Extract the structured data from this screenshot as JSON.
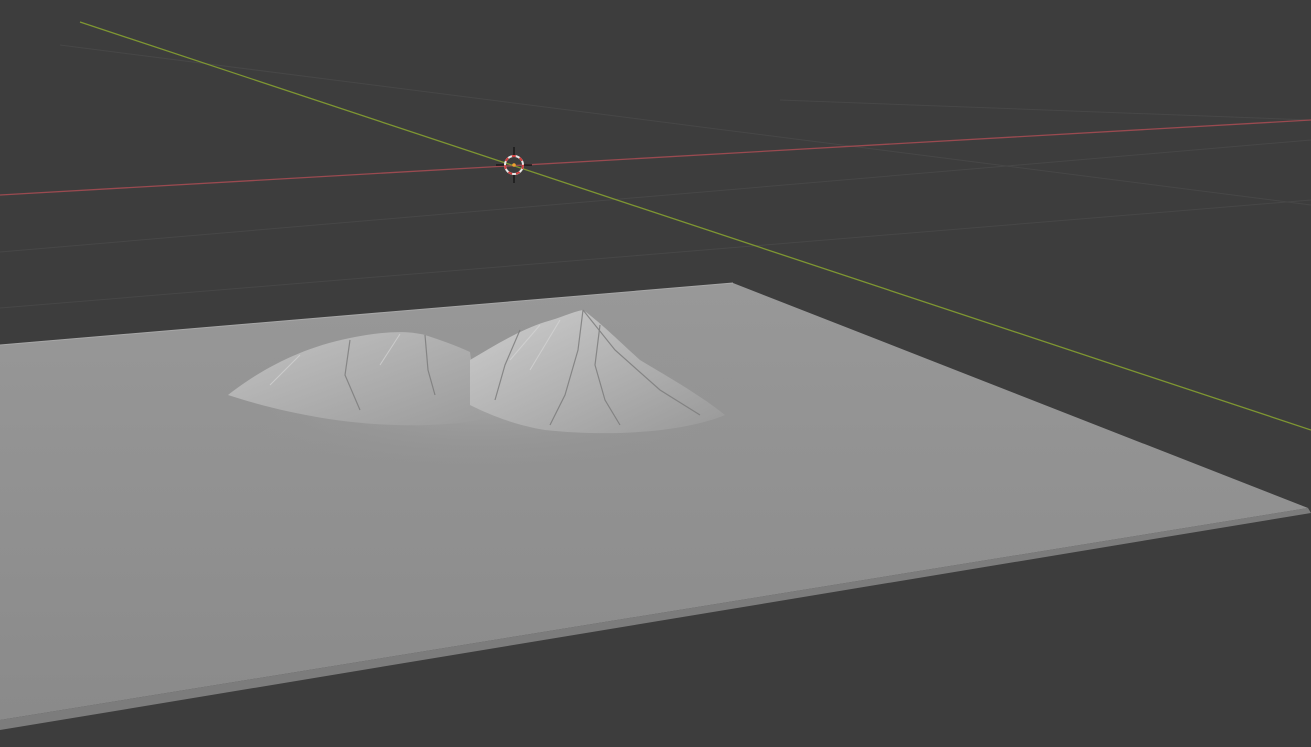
{
  "viewport": {
    "background_color": "#3d3d3d",
    "grid_color": "#454545",
    "x_axis_color": "#9a4a50",
    "y_axis_color": "#7e9632",
    "terrain_color": "#8f8f8f",
    "terrain_highlight_color": "#b9b9b9",
    "cursor_ring_color": "#e8e8e8",
    "cursor_dash_color": "#d04040"
  },
  "objects": {
    "terrain_plane": {
      "icon": "terrain-mesh"
    },
    "mountain": {
      "icon": "mountain-peaks"
    }
  },
  "cursor": {
    "icon": "3d-cursor-icon"
  }
}
